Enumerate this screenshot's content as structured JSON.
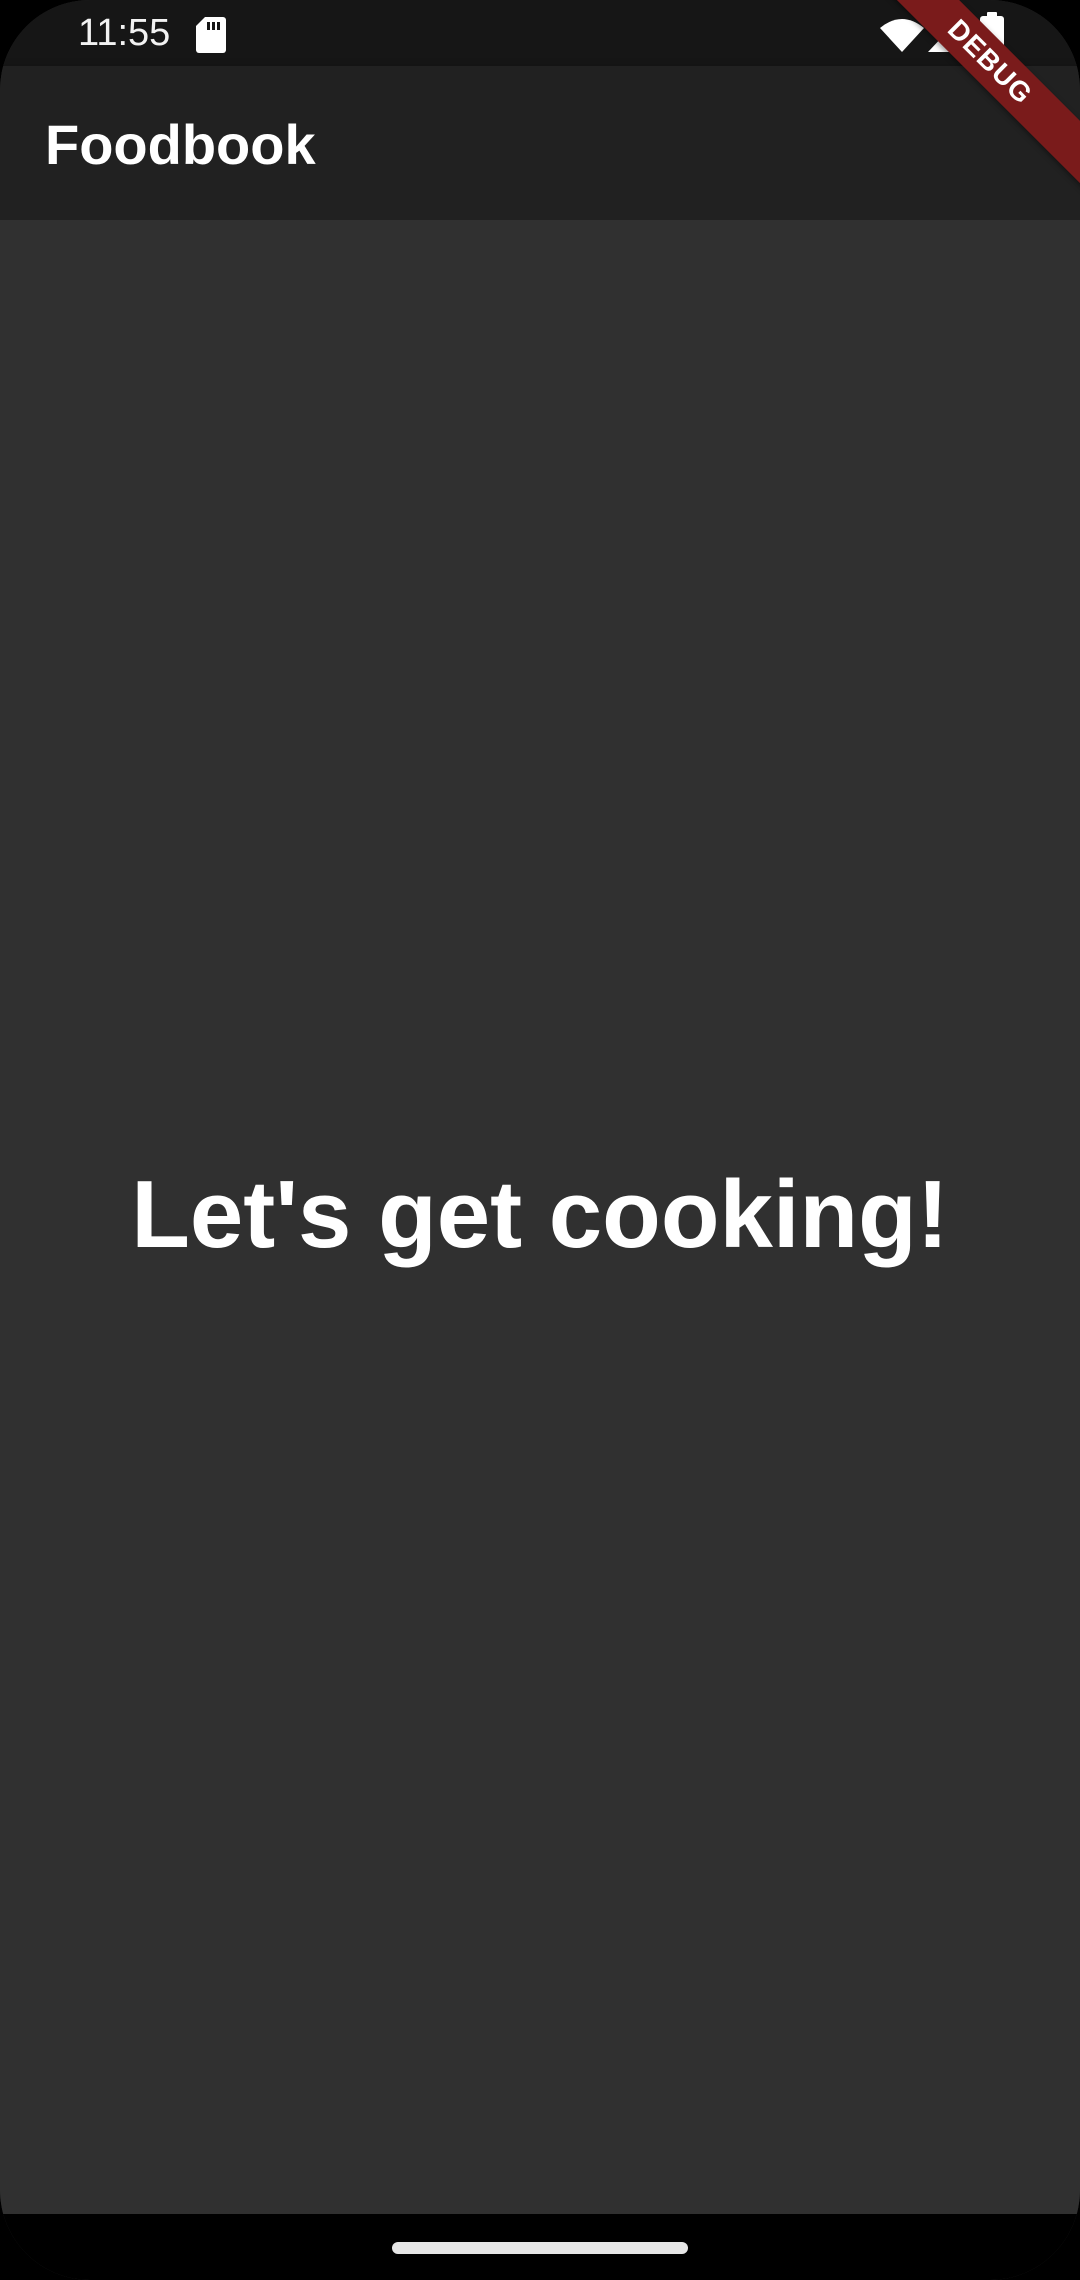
{
  "status_bar": {
    "time": "11:55",
    "icons": [
      "sd-card-icon",
      "wifi-icon",
      "signal-icon",
      "battery-icon"
    ]
  },
  "app_bar": {
    "title": "Foodbook"
  },
  "main": {
    "headline": "Let's get cooking!"
  },
  "debug_banner": {
    "label": "DEBUG"
  },
  "colors": {
    "status_bar_bg": "#161616",
    "app_bar_bg": "#212121",
    "background": "#303030",
    "debug_banner": "#7a1b1b",
    "text": "#ffffff"
  }
}
